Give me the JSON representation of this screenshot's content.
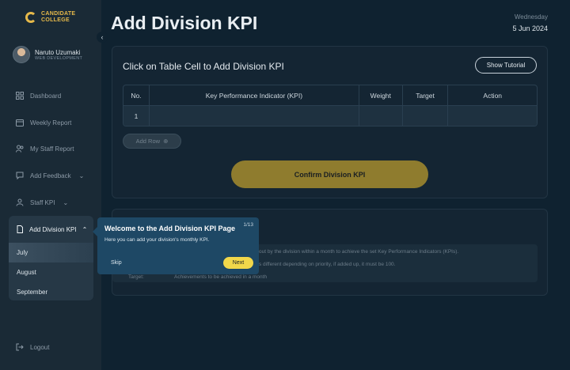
{
  "brand": {
    "line1": "CANDIDATE",
    "line2": "COLLEGE",
    "color": "#e6b94a"
  },
  "profile": {
    "name": "Naruto Uzumaki",
    "role": "WEB DEVELOPMENT"
  },
  "sidebar": {
    "items": [
      {
        "label": "Dashboard",
        "icon": "grid-icon"
      },
      {
        "label": "Weekly Report",
        "icon": "calendar-icon"
      },
      {
        "label": "My Staff Report",
        "icon": "users-icon"
      },
      {
        "label": "Add Feedback",
        "icon": "feedback-icon"
      },
      {
        "label": "Staff KPI",
        "icon": "user-icon"
      },
      {
        "label": "Add Division KPI",
        "icon": "document-icon"
      }
    ],
    "submenu": [
      "July",
      "August",
      "September"
    ],
    "logout": "Logout"
  },
  "header": {
    "title": "Add Division KPI",
    "day": "Wednesday",
    "date": "5 Jun 2024"
  },
  "card": {
    "title": "Click on Table Cell to Add Division KPI",
    "tutorial": "Show Tutorial",
    "table": {
      "headers": [
        "No.",
        "Key Performance Indicator (KPI)",
        "Weight",
        "Target",
        "Action"
      ],
      "rows": [
        [
          "1",
          "",
          "",
          "",
          ""
        ]
      ]
    },
    "add_row": "Add Row",
    "confirm": "Confirm Division KPI"
  },
  "legend": {
    "line1": "out by the division within a month to achieve the set Key Performance Indicators (KPIs).",
    "line2": "s different depending on priority, if added up, it must be 100.",
    "target_key": "Target:",
    "target_text": "Achievements to be achieved in a month"
  },
  "tooltip": {
    "title": "Welcome to the Add Division  KPI Page",
    "step": "1/13",
    "body": "Here you can add your division's monthly KPI.",
    "skip": "Skip",
    "next": "Next"
  },
  "colors": {
    "accent_yellow": "#f1d74a",
    "tooltip_bg": "#1e4865",
    "confirm_bg": "#8f7c2e"
  }
}
